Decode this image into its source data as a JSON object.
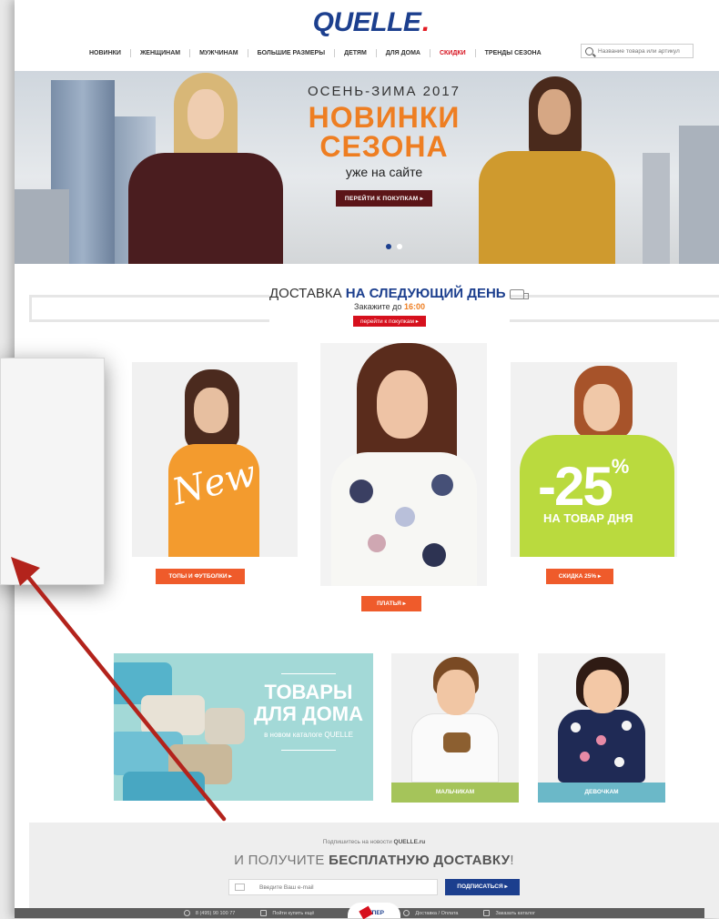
{
  "brand": {
    "logo": "QUELLE",
    "logo_dot": "."
  },
  "nav": {
    "items": [
      "НОВИНКИ",
      "ЖЕНЩИНАМ",
      "МУЖЧИНАМ",
      "БОЛЬШИЕ РАЗМЕРЫ",
      "ДЕТЯМ",
      "ДЛЯ ДОМА",
      "СКИДКИ",
      "ТРЕНДЫ СЕЗОНА"
    ],
    "highlight_color": "#d6101d"
  },
  "search": {
    "placeholder": "Название товара или артикул",
    "icon": "search-icon"
  },
  "hero": {
    "kicker": "ОСЕНЬ-ЗИМА 2017",
    "title_line1": "НОВИНКИ",
    "title_line2": "СЕЗОНА",
    "subtitle": "уже на сайте",
    "button": "ПЕРЕЙТИ К ПОКУПКАМ ▸",
    "slides_total": 2,
    "active_slide": 1,
    "accent_color": "#ee7e22"
  },
  "delivery": {
    "title_prefix": "ДОСТАВКА",
    "title_bold": "НА СЛЕДУЮЩИЙ ДЕНЬ",
    "order_prefix": "Закажите до",
    "order_time": "16:00",
    "button": "перейти к покупкам ▸",
    "icon": "truck-icon"
  },
  "products": {
    "tops": {
      "overlay": "New",
      "button": "ТОПЫ И ФУТБОЛКИ ▸"
    },
    "dresses": {
      "button": "ПЛАТЬЯ ▸"
    },
    "sale": {
      "discount": "-25",
      "percent": "%",
      "caption": "НА ТОВАР ДНЯ",
      "button": "СКИДКА 25% ▸"
    }
  },
  "promos": {
    "home": {
      "title_line1": "ТОВАРЫ",
      "title_line2": "ДЛЯ ДОМА",
      "subtitle": "в новом каталоге QUELLE"
    },
    "boys": {
      "label": "МАЛЬЧИКАМ"
    },
    "girls": {
      "label": "ДЕВОЧКАМ"
    }
  },
  "subscribe": {
    "kicker_prefix": "Подпишитесь на новости",
    "kicker_brand": "QUELLE.ru",
    "title_prefix": "И ПОЛУЧИТЕ",
    "title_bold": "БЕСПЛАТНУЮ ДОСТАВКУ",
    "title_suffix": "!",
    "email_placeholder": "Введите Ваш e-mail",
    "button": "ПОДПИСАТЬСЯ ▸"
  },
  "bottom_bar": {
    "phone": "8 (495) 90 100 77",
    "order_link": "Пойти купить ещё",
    "super_badge": "СУПЕР",
    "returns_link": "Доставка / Оплата",
    "catalog_link": "Заказать каталог"
  }
}
